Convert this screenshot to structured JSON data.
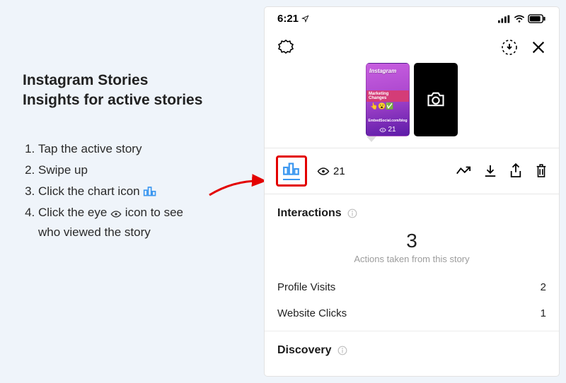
{
  "heading_line1": "Instagram Stories",
  "heading_line2": "Insights for active stories",
  "steps": {
    "s1": "Tap the active story",
    "s2": "Swipe up",
    "s3_a": "Click the chart icon",
    "s4_a": "Click the eye",
    "s4_b": "icon to see",
    "s4_c": "who viewed the story"
  },
  "status": {
    "time": "6:21"
  },
  "thumb": {
    "ig_word": "Instagram",
    "bar_text": "Marketing Changes",
    "blog": "EmbedSocial.com/blog",
    "views": "21"
  },
  "bar": {
    "views": "21"
  },
  "sections": {
    "interactions": "Interactions",
    "big": "3",
    "sub": "Actions taken from this story",
    "pv_label": "Profile Visits",
    "pv_val": "2",
    "wc_label": "Website Clicks",
    "wc_val": "1",
    "discovery": "Discovery"
  }
}
